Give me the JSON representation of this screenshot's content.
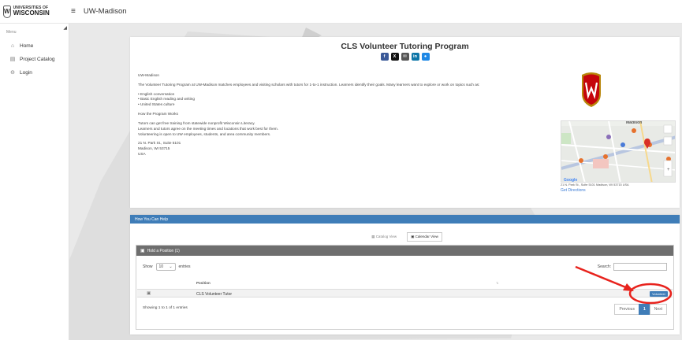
{
  "header": {
    "logo_line1": "UNIVERSITIES OF",
    "logo_line2": "WISCONSIN",
    "title": "UW-Madison"
  },
  "sidebar": {
    "menu_label": "Menu",
    "items": [
      {
        "label": "Home",
        "icon": "home-icon"
      },
      {
        "label": "Project Catalog",
        "icon": "catalog-icon"
      },
      {
        "label": "Login",
        "icon": "login-icon"
      }
    ]
  },
  "program": {
    "title": "CLS Volunteer Tutoring Program",
    "share": [
      "f",
      "X",
      "✉",
      "in",
      "●"
    ],
    "org": "UW-Madison",
    "intro": "The Volunteer Tutoring Program at UW-Madison matches employees and visiting scholars with tutors for 1-to-1 instruction. Learners identify their goals. Many learners want to explore or work on topics such as:",
    "bullets": [
      "• English conversation",
      "• Basic English reading and writing",
      "• United States culture"
    ],
    "how_heading": "How the Program Works",
    "how_lines": [
      "Tutors can get free training from statewide nonprofit Wisconsin Literacy.",
      "Learners and tutors agree on the meeting times and locations that work best for them.",
      "Volunteering is open to UW employees, students, and area community members."
    ],
    "address": [
      "21 N. Park St., Suite 5101",
      "Madison, WI 53715",
      "USA"
    ],
    "map_caption": "21 N. Park St., Suite 5101 Madison, WI 53715 USA",
    "map_city": "Madison",
    "get_directions": "Get Directions"
  },
  "help": {
    "header": "How You Can Help",
    "tab_catalog": "Catalog View",
    "tab_calendar": "Calendar View",
    "panel_title": "Hold a Position (1)",
    "show": "Show",
    "entries_value": "10",
    "entries": "entries",
    "search_label": "Search:",
    "col_position": "Position",
    "rows": [
      {
        "position": "CLS Volunteer Tutor",
        "action": "Volunteer"
      }
    ],
    "info": "Showing 1 to 1 of 1 entries",
    "prev": "Previous",
    "page": "1",
    "next": "Next"
  },
  "colors": {
    "accent": "#3f7db8",
    "annotation": "#e8231d",
    "crest": "#c5050c"
  }
}
